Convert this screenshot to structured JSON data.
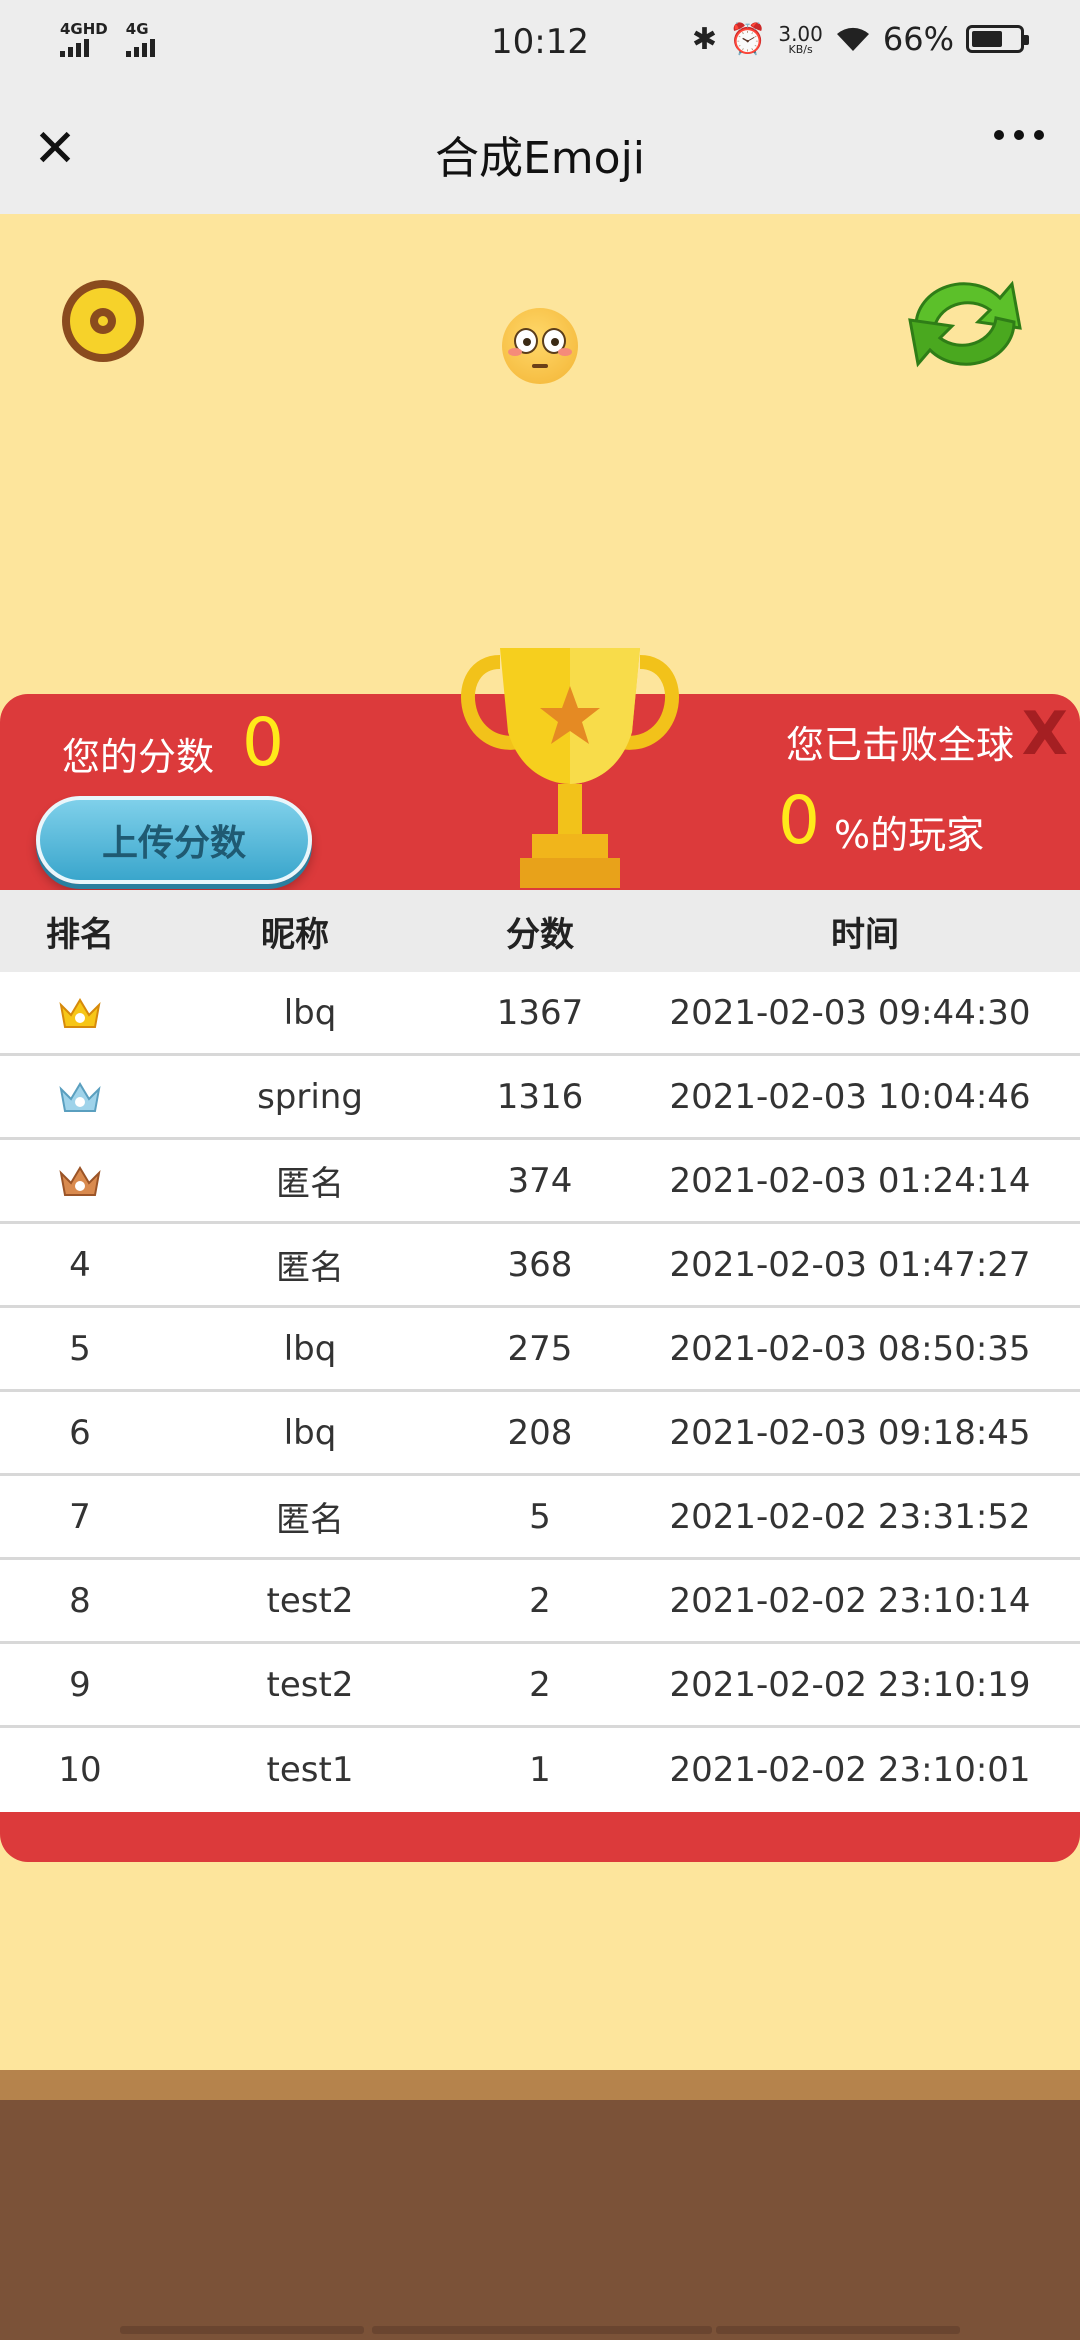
{
  "status_bar": {
    "signal1_label": "4GHD",
    "signal2_label": "4G",
    "time": "10:12",
    "speed_value": "3.00",
    "speed_unit": "KB/s",
    "battery_percent": "66%",
    "battery_level": 0.66
  },
  "title_bar": {
    "title": "合成Emoji"
  },
  "panel": {
    "score_label": "您的分数",
    "score_value": "0",
    "upload_button": "上传分数",
    "beat_text": "您已击败全球",
    "percent_value": "0",
    "percent_label": "%的玩家",
    "close_label": "X"
  },
  "table": {
    "headers": [
      "排名",
      "昵称",
      "分数",
      "时间"
    ],
    "rows": [
      {
        "rank": "",
        "rank_icon": "gold-crown-icon",
        "name": "lbq",
        "score": "1367",
        "time": "2021-02-03 09:44:30"
      },
      {
        "rank": "",
        "rank_icon": "silver-crown-icon",
        "name": "spring",
        "score": "1316",
        "time": "2021-02-03 10:04:46"
      },
      {
        "rank": "",
        "rank_icon": "bronze-crown-icon",
        "name": "匿名",
        "score": "374",
        "time": "2021-02-03 01:24:14"
      },
      {
        "rank": "4",
        "name": "匿名",
        "score": "368",
        "time": "2021-02-03 01:47:27"
      },
      {
        "rank": "5",
        "name": "lbq",
        "score": "275",
        "time": "2021-02-03 08:50:35"
      },
      {
        "rank": "6",
        "name": "lbq",
        "score": "208",
        "time": "2021-02-03 09:18:45"
      },
      {
        "rank": "7",
        "name": "匿名",
        "score": "5",
        "time": "2021-02-02 23:31:52"
      },
      {
        "rank": "8",
        "name": "test2",
        "score": "2",
        "time": "2021-02-02 23:10:14"
      },
      {
        "rank": "9",
        "name": "test2",
        "score": "2",
        "time": "2021-02-02 23:10:19"
      },
      {
        "rank": "10",
        "name": "test1",
        "score": "1",
        "time": "2021-02-02 23:10:01"
      }
    ]
  },
  "colors": {
    "background": "#fde59c",
    "panel_red": "#dc3a3b",
    "score_yellow": "#ffe91a",
    "upload_blue": "#3aa6cc",
    "ground_brown": "#7b5238"
  }
}
